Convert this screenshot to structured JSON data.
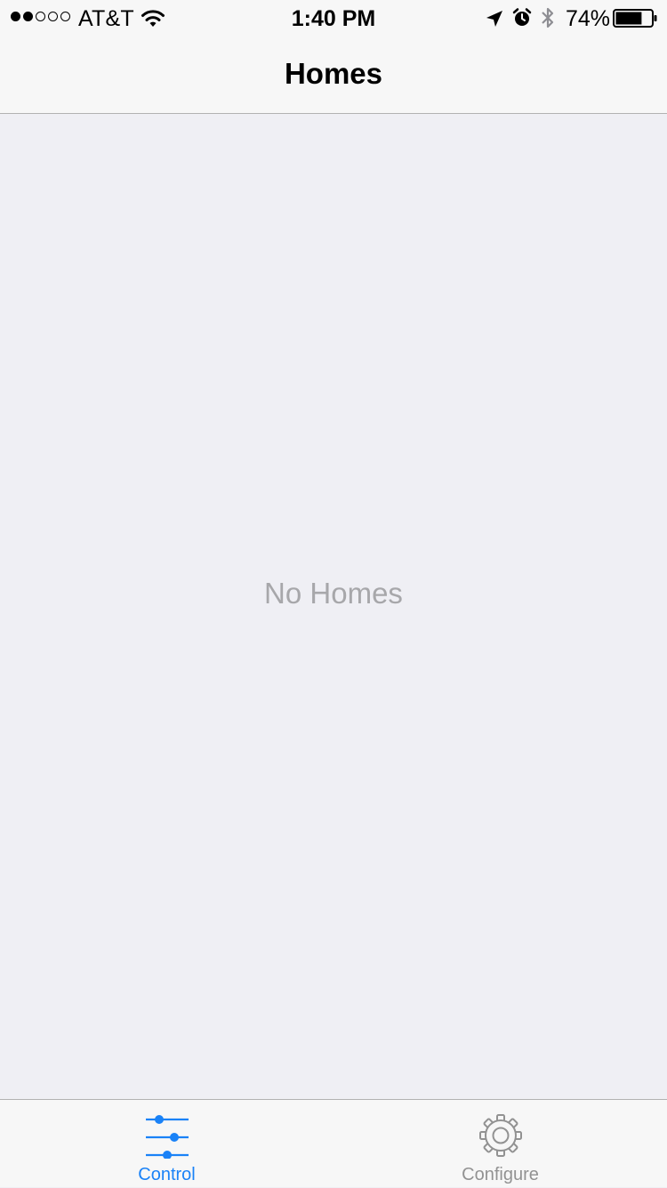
{
  "status_bar": {
    "carrier": "AT&T",
    "time": "1:40 PM",
    "battery_percent": "74%",
    "battery_level": 0.74,
    "signal_bars_filled": 2,
    "signal_bars_total": 5,
    "icons": [
      "wifi-icon",
      "location-arrow-icon",
      "alarm-clock-icon",
      "bluetooth-icon",
      "battery-icon"
    ]
  },
  "nav": {
    "title": "Homes"
  },
  "main": {
    "empty_message": "No Homes"
  },
  "tab_bar": {
    "tabs": [
      {
        "label": "Control",
        "icon": "sliders-icon",
        "selected": true
      },
      {
        "label": "Configure",
        "icon": "gear-icon",
        "selected": false
      }
    ]
  },
  "colors": {
    "accent": "#1a82f7",
    "inactive": "#929292",
    "background": "#efeff4",
    "bar_background": "#f7f7f7",
    "empty_text": "#a7a7aa"
  }
}
